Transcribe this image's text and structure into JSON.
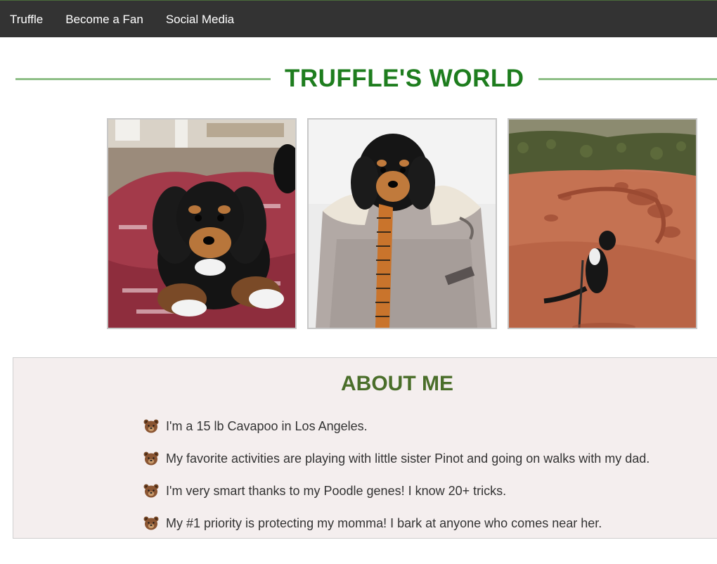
{
  "nav": {
    "items": [
      {
        "label": "Truffle"
      },
      {
        "label": "Become a Fan"
      },
      {
        "label": "Social Media"
      }
    ]
  },
  "header": {
    "title": "TRUFFLE'S WORLD"
  },
  "gallery": {
    "photos": [
      {
        "icon": "puppy-on-cushion-photo"
      },
      {
        "icon": "puppy-in-bag-photo"
      },
      {
        "icon": "dog-on-red-rocks-photo"
      }
    ]
  },
  "about": {
    "title": "ABOUT ME",
    "bullet_icon": "bear-face-emoji",
    "items": [
      {
        "text": "I'm a 15 lb Cavapoo in Los Angeles."
      },
      {
        "text": "My favorite activities are playing with little sister Pinot and going on walks with my dad."
      },
      {
        "text": "I'm very smart thanks to my Poodle genes! I know 20+ tricks."
      },
      {
        "text": "My #1 priority is protecting my momma! I bark at anyone who comes near her."
      }
    ]
  },
  "colors": {
    "navbar_bg": "#333333",
    "title_green": "#1e7d1e",
    "title_line": "#8fbf88",
    "about_bg": "#f4eeee",
    "about_title": "#4a6e2a"
  }
}
